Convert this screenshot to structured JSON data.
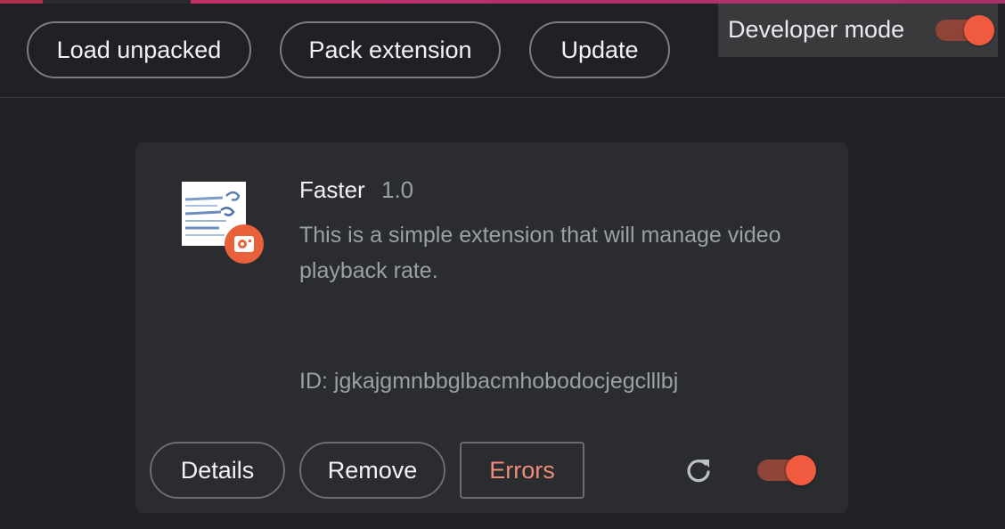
{
  "toolbar": {
    "load_unpacked": "Load unpacked",
    "pack_extension": "Pack extension",
    "update": "Update"
  },
  "developer_mode": {
    "label": "Developer mode",
    "enabled": true
  },
  "extension": {
    "name": "Faster",
    "version": "1.0",
    "description": "This is a simple extension that will manage video playback rate.",
    "id_text": "ID: jgkajgmnbbglbacmhobodocjegclllbj",
    "enabled": true,
    "details_label": "Details",
    "remove_label": "Remove",
    "errors_label": "Errors",
    "icon": "faster-extension-icon",
    "badge_icon": "unpacked-extension-badge-icon",
    "reload_icon": "reload-icon"
  },
  "colors": {
    "accent": "#f05a3e",
    "error_text": "#ee8d7c",
    "background": "#202124",
    "card": "#2b2c30"
  }
}
